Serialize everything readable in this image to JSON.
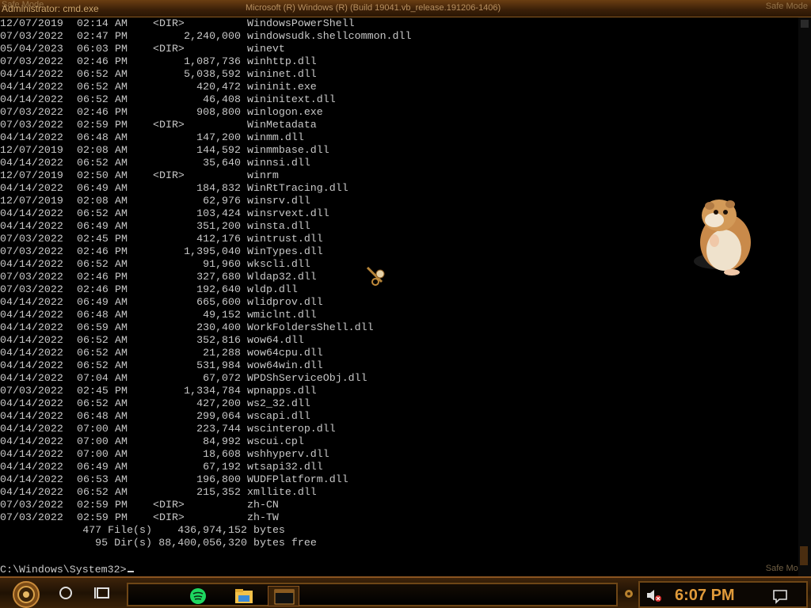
{
  "window": {
    "title": "Administrator: cmd.exe",
    "center_caption": "Microsoft (R) Windows (R) (Build 19041.vb_release.191206-1406)",
    "watermark_left": "Safe Mode",
    "watermark_right": "Safe Mode",
    "watermark_bottom": "Safe Mode"
  },
  "listing": [
    {
      "date": "12/07/2019",
      "time": "02:14",
      "ampm": "AM",
      "dir": "<DIR>",
      "size": "",
      "name": "WindowsPowerShell"
    },
    {
      "date": "07/03/2022",
      "time": "02:47",
      "ampm": "PM",
      "dir": "",
      "size": "2,240,000",
      "name": "windowsudk.shellcommon.dll"
    },
    {
      "date": "05/04/2023",
      "time": "06:03",
      "ampm": "PM",
      "dir": "<DIR>",
      "size": "",
      "name": "winevt"
    },
    {
      "date": "07/03/2022",
      "time": "02:46",
      "ampm": "PM",
      "dir": "",
      "size": "1,087,736",
      "name": "winhttp.dll"
    },
    {
      "date": "04/14/2022",
      "time": "06:52",
      "ampm": "AM",
      "dir": "",
      "size": "5,038,592",
      "name": "wininet.dll"
    },
    {
      "date": "04/14/2022",
      "time": "06:52",
      "ampm": "AM",
      "dir": "",
      "size": "420,472",
      "name": "wininit.exe"
    },
    {
      "date": "04/14/2022",
      "time": "06:52",
      "ampm": "AM",
      "dir": "",
      "size": "46,408",
      "name": "wininitext.dll"
    },
    {
      "date": "07/03/2022",
      "time": "02:46",
      "ampm": "PM",
      "dir": "",
      "size": "908,800",
      "name": "winlogon.exe"
    },
    {
      "date": "07/03/2022",
      "time": "02:59",
      "ampm": "PM",
      "dir": "<DIR>",
      "size": "",
      "name": "WinMetadata"
    },
    {
      "date": "04/14/2022",
      "time": "06:48",
      "ampm": "AM",
      "dir": "",
      "size": "147,200",
      "name": "winmm.dll"
    },
    {
      "date": "12/07/2019",
      "time": "02:08",
      "ampm": "AM",
      "dir": "",
      "size": "144,592",
      "name": "winmmbase.dll"
    },
    {
      "date": "04/14/2022",
      "time": "06:52",
      "ampm": "AM",
      "dir": "",
      "size": "35,640",
      "name": "winnsi.dll"
    },
    {
      "date": "12/07/2019",
      "time": "02:50",
      "ampm": "AM",
      "dir": "<DIR>",
      "size": "",
      "name": "winrm"
    },
    {
      "date": "04/14/2022",
      "time": "06:49",
      "ampm": "AM",
      "dir": "",
      "size": "184,832",
      "name": "WinRtTracing.dll"
    },
    {
      "date": "12/07/2019",
      "time": "02:08",
      "ampm": "AM",
      "dir": "",
      "size": "62,976",
      "name": "winsrv.dll"
    },
    {
      "date": "04/14/2022",
      "time": "06:52",
      "ampm": "AM",
      "dir": "",
      "size": "103,424",
      "name": "winsrvext.dll"
    },
    {
      "date": "04/14/2022",
      "time": "06:49",
      "ampm": "AM",
      "dir": "",
      "size": "351,200",
      "name": "winsta.dll"
    },
    {
      "date": "07/03/2022",
      "time": "02:45",
      "ampm": "PM",
      "dir": "",
      "size": "412,176",
      "name": "wintrust.dll"
    },
    {
      "date": "07/03/2022",
      "time": "02:46",
      "ampm": "PM",
      "dir": "",
      "size": "1,395,040",
      "name": "WinTypes.dll"
    },
    {
      "date": "04/14/2022",
      "time": "06:52",
      "ampm": "AM",
      "dir": "",
      "size": "91,960",
      "name": "wkscli.dll"
    },
    {
      "date": "07/03/2022",
      "time": "02:46",
      "ampm": "PM",
      "dir": "",
      "size": "327,680",
      "name": "Wldap32.dll"
    },
    {
      "date": "07/03/2022",
      "time": "02:46",
      "ampm": "PM",
      "dir": "",
      "size": "192,640",
      "name": "wldp.dll"
    },
    {
      "date": "04/14/2022",
      "time": "06:49",
      "ampm": "AM",
      "dir": "",
      "size": "665,600",
      "name": "wlidprov.dll"
    },
    {
      "date": "04/14/2022",
      "time": "06:48",
      "ampm": "AM",
      "dir": "",
      "size": "49,152",
      "name": "wmiclnt.dll"
    },
    {
      "date": "04/14/2022",
      "time": "06:59",
      "ampm": "AM",
      "dir": "",
      "size": "230,400",
      "name": "WorkFoldersShell.dll"
    },
    {
      "date": "04/14/2022",
      "time": "06:52",
      "ampm": "AM",
      "dir": "",
      "size": "352,816",
      "name": "wow64.dll"
    },
    {
      "date": "04/14/2022",
      "time": "06:52",
      "ampm": "AM",
      "dir": "",
      "size": "21,288",
      "name": "wow64cpu.dll"
    },
    {
      "date": "04/14/2022",
      "time": "06:52",
      "ampm": "AM",
      "dir": "",
      "size": "531,984",
      "name": "wow64win.dll"
    },
    {
      "date": "04/14/2022",
      "time": "07:04",
      "ampm": "AM",
      "dir": "",
      "size": "67,072",
      "name": "WPDShServiceObj.dll"
    },
    {
      "date": "07/03/2022",
      "time": "02:45",
      "ampm": "PM",
      "dir": "",
      "size": "1,334,784",
      "name": "wpnapps.dll"
    },
    {
      "date": "04/14/2022",
      "time": "06:52",
      "ampm": "AM",
      "dir": "",
      "size": "427,200",
      "name": "ws2_32.dll"
    },
    {
      "date": "04/14/2022",
      "time": "06:48",
      "ampm": "AM",
      "dir": "",
      "size": "299,064",
      "name": "wscapi.dll"
    },
    {
      "date": "04/14/2022",
      "time": "07:00",
      "ampm": "AM",
      "dir": "",
      "size": "223,744",
      "name": "wscinterop.dll"
    },
    {
      "date": "04/14/2022",
      "time": "07:00",
      "ampm": "AM",
      "dir": "",
      "size": "84,992",
      "name": "wscui.cpl"
    },
    {
      "date": "04/14/2022",
      "time": "07:00",
      "ampm": "AM",
      "dir": "",
      "size": "18,608",
      "name": "wshhyperv.dll"
    },
    {
      "date": "04/14/2022",
      "time": "06:49",
      "ampm": "AM",
      "dir": "",
      "size": "67,192",
      "name": "wtsapi32.dll"
    },
    {
      "date": "04/14/2022",
      "time": "06:53",
      "ampm": "AM",
      "dir": "",
      "size": "196,800",
      "name": "WUDFPlatform.dll"
    },
    {
      "date": "04/14/2022",
      "time": "06:52",
      "ampm": "AM",
      "dir": "",
      "size": "215,352",
      "name": "xmllite.dll"
    },
    {
      "date": "07/03/2022",
      "time": "02:59",
      "ampm": "PM",
      "dir": "<DIR>",
      "size": "",
      "name": "zh-CN"
    },
    {
      "date": "07/03/2022",
      "time": "02:59",
      "ampm": "PM",
      "dir": "<DIR>",
      "size": "",
      "name": "zh-TW"
    }
  ],
  "summary": {
    "files_count": "477 File(s)",
    "files_bytes": "436,974,152",
    "files_label": "bytes",
    "dirs_count": "95 Dir(s)",
    "dirs_bytes": "88,400,056,320",
    "dirs_label": "bytes free"
  },
  "prompt": "C:\\Windows\\System32>",
  "taskbar": {
    "clock": "6:07 PM",
    "accent": "#e09a3a",
    "icons": [
      "start-gear-icon",
      "cortana-circle-icon",
      "task-view-icon",
      "spotify-icon",
      "file-explorer-icon",
      "cmd-window-icon",
      "volume-muted-icon",
      "notification-icon"
    ]
  }
}
